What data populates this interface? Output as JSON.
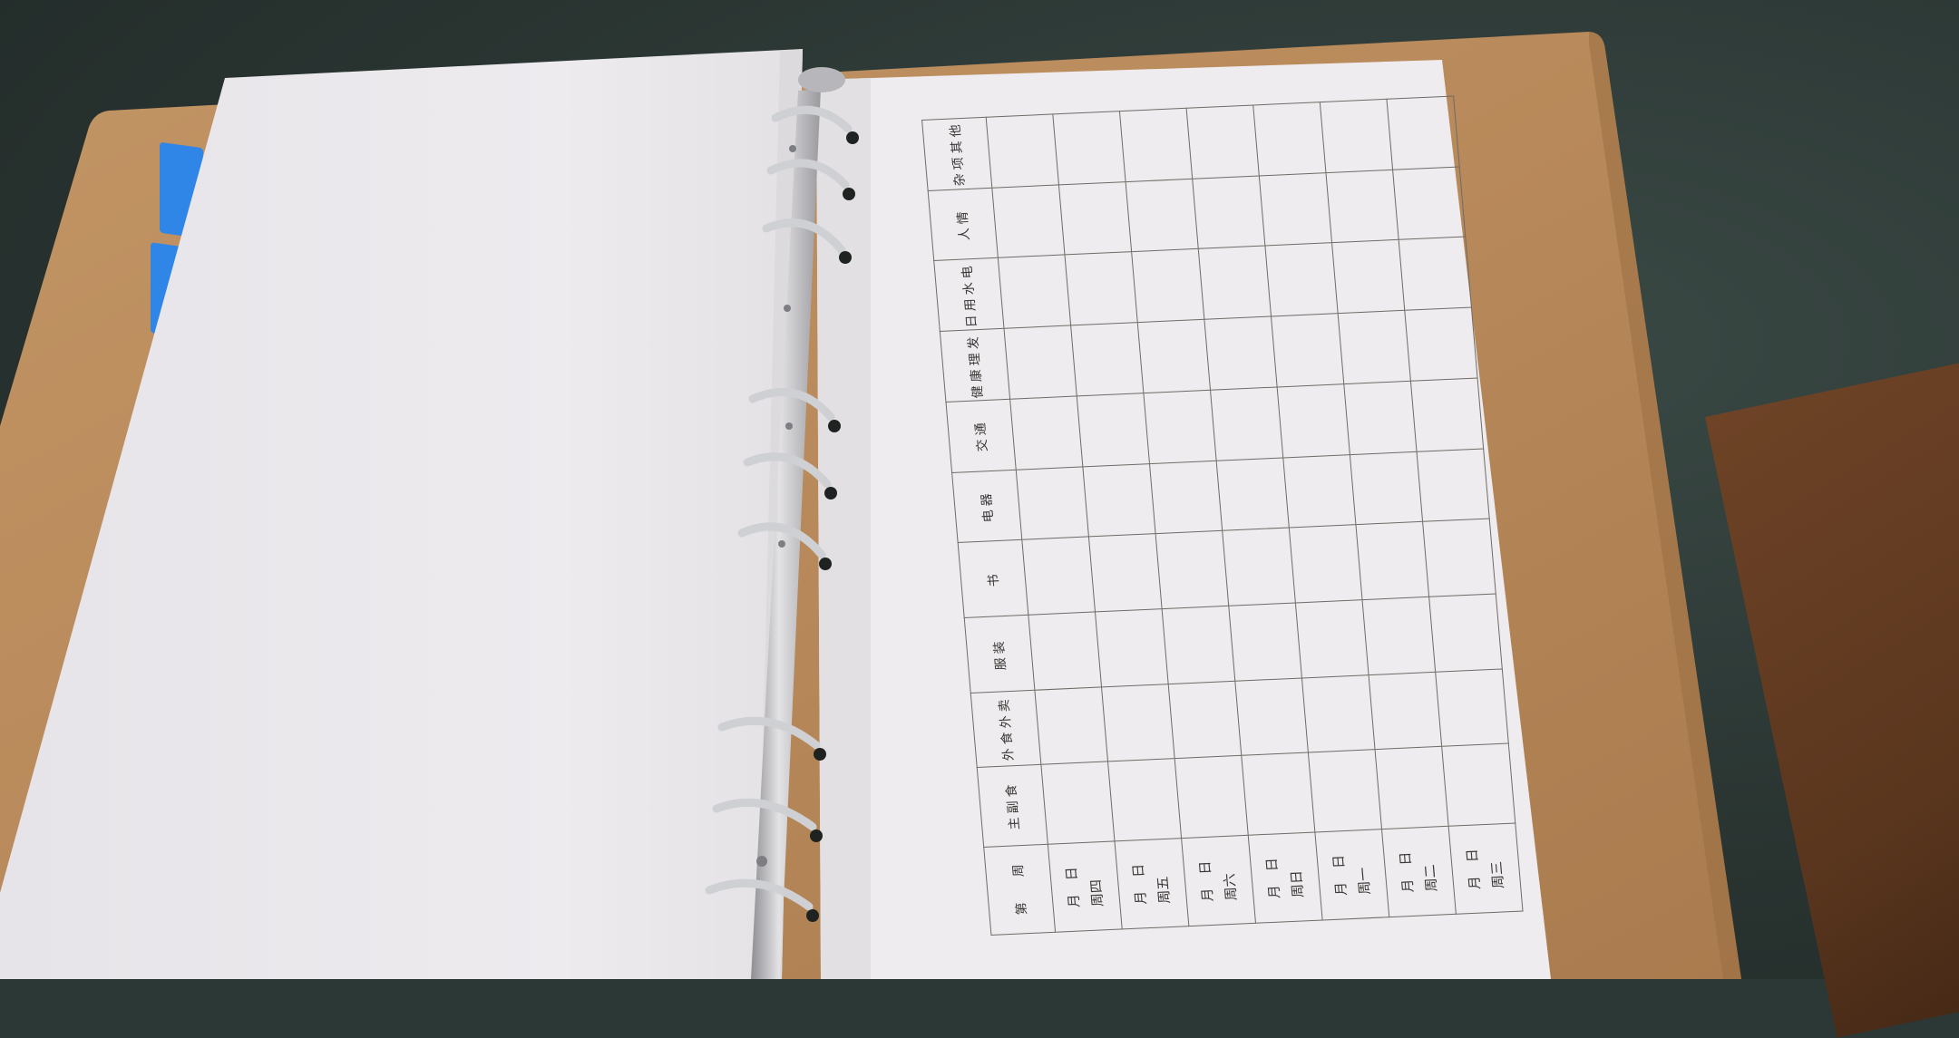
{
  "ledger": {
    "corner": {
      "a": "周",
      "b": "第"
    },
    "categories": [
      "主副食",
      "外食外卖",
      "服装",
      "书",
      "电器",
      "交通",
      "健康理发",
      "日用水电",
      "人情",
      "杂项其他"
    ],
    "days": [
      {
        "line1": "月　日",
        "line2": "周四"
      },
      {
        "line1": "月　日",
        "line2": "周五"
      },
      {
        "line1": "月　日",
        "line2": "周六"
      },
      {
        "line1": "月　日",
        "line2": "周日"
      },
      {
        "line1": "月　日",
        "line2": "周一"
      },
      {
        "line1": "月　日",
        "line2": "周二"
      },
      {
        "line1": "月　日",
        "line2": "周三"
      }
    ]
  },
  "colors": {
    "kraft": "#b98b5e",
    "paper": "#ebe9ec",
    "tab_blue": "#2f86e6",
    "ring_silver": "#c9c9cc"
  }
}
